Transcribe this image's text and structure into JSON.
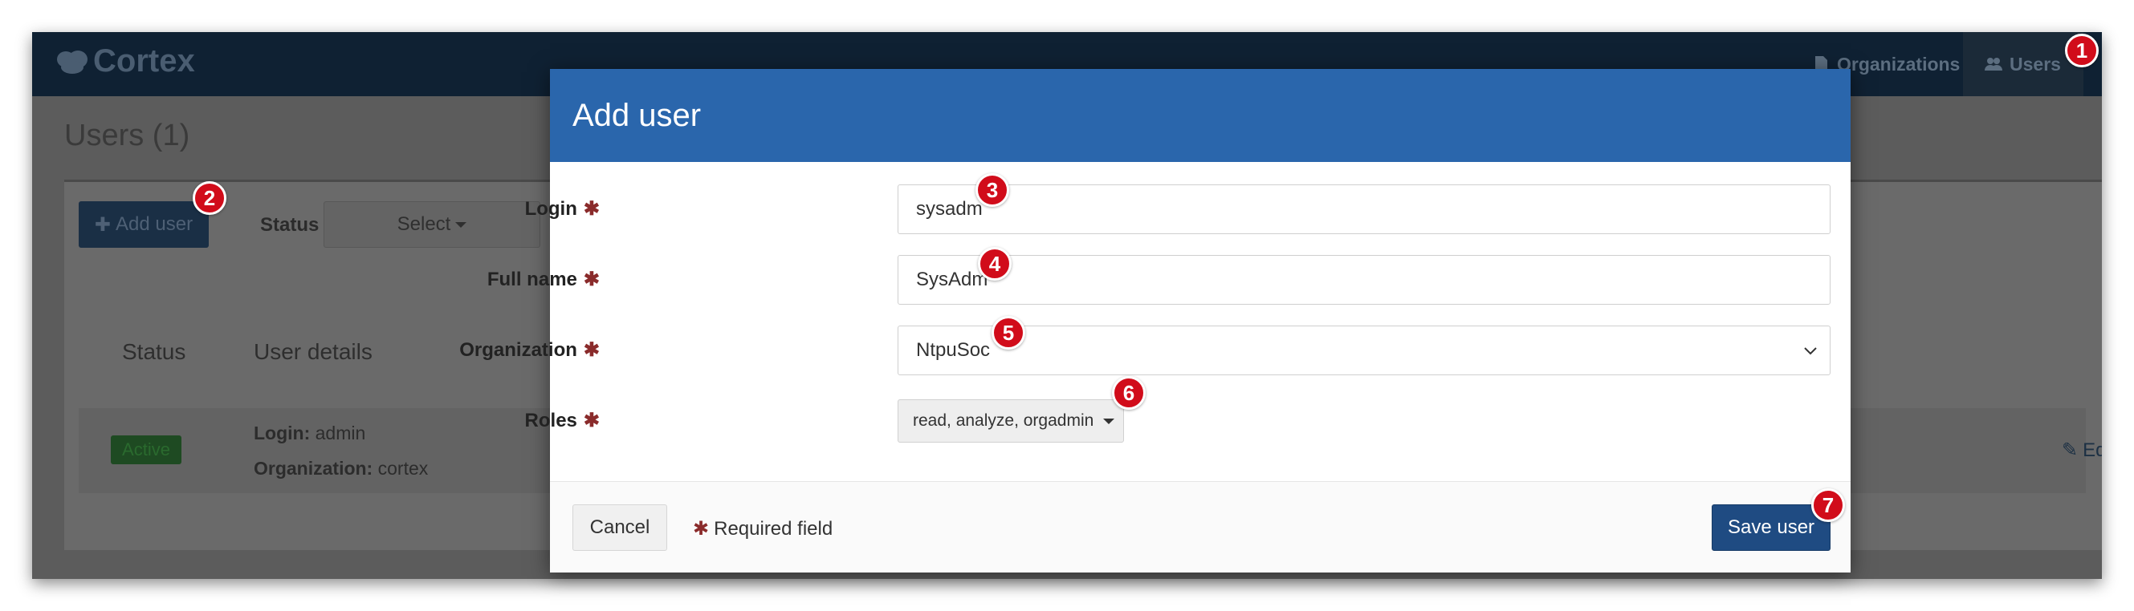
{
  "app": {
    "brand": "Cortex"
  },
  "nav": {
    "organizations": "Organizations",
    "users": "Users"
  },
  "page": {
    "title": "Users (1)"
  },
  "toolbar": {
    "add_user": "Add user",
    "status_label": "Status",
    "select_label": "Select"
  },
  "table": {
    "headers": [
      "Status",
      "User details"
    ],
    "rows": [
      {
        "status": "Active",
        "login_label": "Login:",
        "login": "admin",
        "org_label": "Organization:",
        "org": "cortex",
        "edit": "Edit"
      }
    ]
  },
  "modal": {
    "title": "Add user",
    "fields": {
      "login": {
        "label": "Login",
        "value": "sysadm"
      },
      "fullname": {
        "label": "Full name",
        "value": "SysAdm"
      },
      "organization": {
        "label": "Organization",
        "value": "NtpuSoc"
      },
      "roles": {
        "label": "Roles",
        "value": "read, analyze, orgadmin"
      }
    },
    "required_mark": "✱",
    "cancel": "Cancel",
    "required_note": "Required field",
    "save": "Save user"
  },
  "markers": [
    "1",
    "2",
    "3",
    "4",
    "5",
    "6",
    "7"
  ],
  "colors": {
    "header_blue": "#2a66ac",
    "save_blue": "#1f4b82",
    "required_red": "#8a2b2b",
    "marker_red": "#d10c1a"
  }
}
